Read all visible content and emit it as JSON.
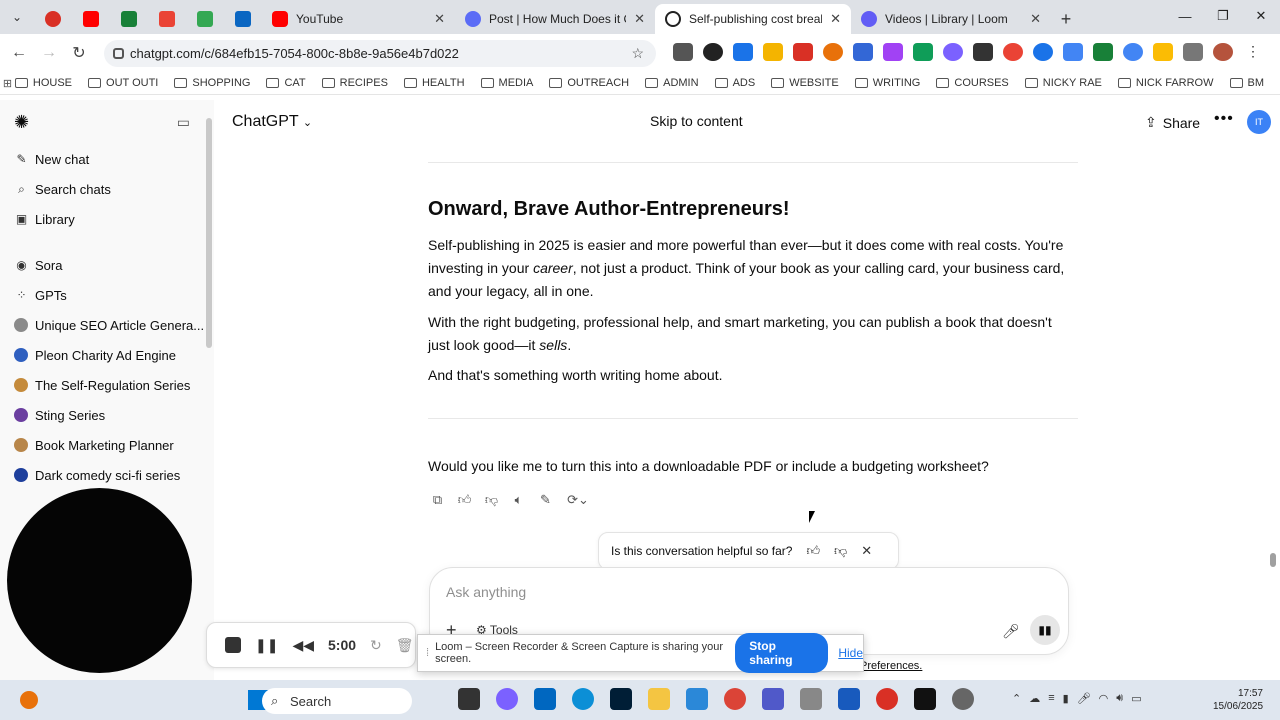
{
  "browser": {
    "tabs": [
      {
        "title": "YouTube",
        "color": "#ff0000",
        "active": false
      },
      {
        "title": "Post | How Much Does it Cost to",
        "color": "#5b6cf6",
        "active": false
      },
      {
        "title": "Self-publishing cost breakd",
        "color": "#222222",
        "active": true
      },
      {
        "title": "Videos | Library | Loom",
        "color": "#625df5",
        "active": false
      }
    ],
    "url": "chatgpt.com/c/684efb15-7054-800c-8b8e-9a56e4b7d022",
    "bookmarks": [
      "HOUSE",
      "OUT OUTI",
      "SHOPPING",
      "CAT",
      "RECIPES",
      "HEALTH",
      "MEDIA",
      "OUTREACH",
      "ADMIN",
      "ADS",
      "WEBSITE",
      "WRITING",
      "COURSES",
      "NICKY RAE",
      "NICK FARROW",
      "BM"
    ]
  },
  "sidebar": {
    "new_chat": "New chat",
    "search": "Search chats",
    "library": "Library",
    "sora": "Sora",
    "gpts": "GPTs",
    "gpt_items": [
      "Unique SEO Article Genera...",
      "Pleon Charity Ad Engine",
      "The Self-Regulation Series",
      "Sting Series",
      "Book Marketing Planner",
      "Dark comedy sci-fi series"
    ]
  },
  "header": {
    "model": "ChatGPT",
    "skip": "Skip to content",
    "share": "Share",
    "avatar": "IT"
  },
  "message": {
    "heading": "Onward, Brave Author-Entrepreneurs!",
    "p1_a": "Self-publishing in 2025 is easier and more powerful than ever—but it does come with real costs. You're investing in your ",
    "p1_em": "career",
    "p1_b": ", not just a product. Think of your book as your calling card, your business card, and your legacy, all in one.",
    "p2_a": "With the right budgeting, professional help, and smart marketing, you can publish a book that doesn't just look good—it ",
    "p2_em": "sells",
    "p2_b": ".",
    "p3": "And that's something worth writing home about.",
    "question": "Would you like me to turn this into a downloadable PDF or include a budgeting worksheet?"
  },
  "feedback": {
    "prompt": "Is this conversation helpful so far?"
  },
  "composer": {
    "placeholder": "Ask anything",
    "tools": "Tools"
  },
  "footer_link": "Preferences.",
  "loom": {
    "timer": "5:00",
    "notice": "Loom – Screen Recorder & Screen Capture is sharing your screen.",
    "stop": "Stop sharing",
    "hide": "Hide"
  },
  "taskbar": {
    "search": "Search",
    "time": "17:57",
    "date": "15/06/2025"
  }
}
